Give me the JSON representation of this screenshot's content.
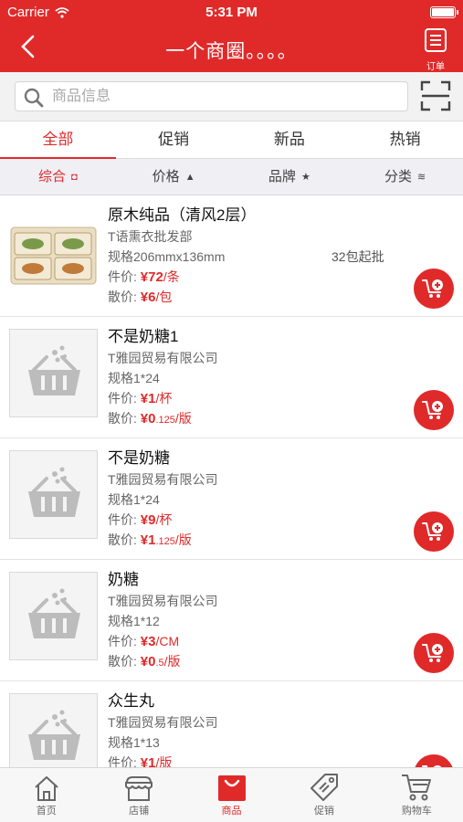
{
  "status_bar": {
    "carrier": "Carrier",
    "time": "5:31 PM"
  },
  "nav": {
    "title": "一个商圈。。。。",
    "order_label": "订单"
  },
  "search": {
    "placeholder": "商品信息"
  },
  "tabs": [
    {
      "label": "全部",
      "active": true
    },
    {
      "label": "促销",
      "active": false
    },
    {
      "label": "新品",
      "active": false
    },
    {
      "label": "热销",
      "active": false
    }
  ],
  "sort_options": [
    {
      "label": "综合",
      "icon": "square-icon",
      "symbol": "◘",
      "active": true
    },
    {
      "label": "价格",
      "icon": "triangle-up-icon",
      "symbol": "▲",
      "active": false
    },
    {
      "label": "品牌",
      "icon": "star-icon",
      "symbol": "★",
      "active": false
    },
    {
      "label": "分类",
      "icon": "layers-icon",
      "symbol": "≋",
      "active": false
    }
  ],
  "products": [
    {
      "name": "原木纯品（清风2层）",
      "supplier": "T语熏衣批发部",
      "spec": "规格206mmx136mm",
      "min_order": "32包起批",
      "unit_price_label": "件价:",
      "unit_price_currency": "¥",
      "unit_price_int": "72",
      "unit_price_dec": "",
      "unit_price_unit": "/条",
      "piece_price_label": "散价:",
      "piece_price_currency": "¥",
      "piece_price_int": "6",
      "piece_price_dec": "",
      "piece_price_unit": "/包",
      "has_photo": true
    },
    {
      "name": "不是奶糖1",
      "supplier": "T雅园贸易有限公司",
      "spec": "规格1*24",
      "min_order": "",
      "unit_price_label": "件价:",
      "unit_price_currency": "¥",
      "unit_price_int": "1",
      "unit_price_dec": "",
      "unit_price_unit": "/杯",
      "piece_price_label": "散价:",
      "piece_price_currency": "¥",
      "piece_price_int": "0",
      "piece_price_dec": ".125",
      "piece_price_unit": "/版",
      "has_photo": false
    },
    {
      "name": "不是奶糖",
      "supplier": "T雅园贸易有限公司",
      "spec": "规格1*24",
      "min_order": "",
      "unit_price_label": "件价:",
      "unit_price_currency": "¥",
      "unit_price_int": "9",
      "unit_price_dec": "",
      "unit_price_unit": "/杯",
      "piece_price_label": "散价:",
      "piece_price_currency": "¥",
      "piece_price_int": "1",
      "piece_price_dec": ".125",
      "piece_price_unit": "/版",
      "has_photo": false
    },
    {
      "name": "奶糖",
      "supplier": "T雅园贸易有限公司",
      "spec": "规格1*12",
      "min_order": "",
      "unit_price_label": "件价:",
      "unit_price_currency": "¥",
      "unit_price_int": "3",
      "unit_price_dec": "",
      "unit_price_unit": "/CM",
      "piece_price_label": "散价:",
      "piece_price_currency": "¥",
      "piece_price_int": "0",
      "piece_price_dec": ".5",
      "piece_price_unit": "/版",
      "has_photo": false
    },
    {
      "name": "众生丸",
      "supplier": "T雅园贸易有限公司",
      "spec": "规格1*13",
      "min_order": "",
      "unit_price_label": "件价:",
      "unit_price_currency": "¥",
      "unit_price_int": "1",
      "unit_price_dec": "",
      "unit_price_unit": "/版",
      "piece_price_label": "",
      "piece_price_currency": "",
      "piece_price_int": "",
      "piece_price_dec": "",
      "piece_price_unit": "",
      "has_photo": false
    }
  ],
  "bottom_tabs": [
    {
      "label": "首页",
      "icon": "home-icon",
      "active": false
    },
    {
      "label": "店铺",
      "icon": "store-icon",
      "active": false
    },
    {
      "label": "商品",
      "icon": "shopping-bag-icon",
      "active": true
    },
    {
      "label": "促销",
      "icon": "price-tag-icon",
      "active": false
    },
    {
      "label": "购物车",
      "icon": "cart-icon",
      "active": false
    }
  ],
  "colors": {
    "brand_red": "#e02a2a",
    "background_gray": "#efeff4"
  }
}
